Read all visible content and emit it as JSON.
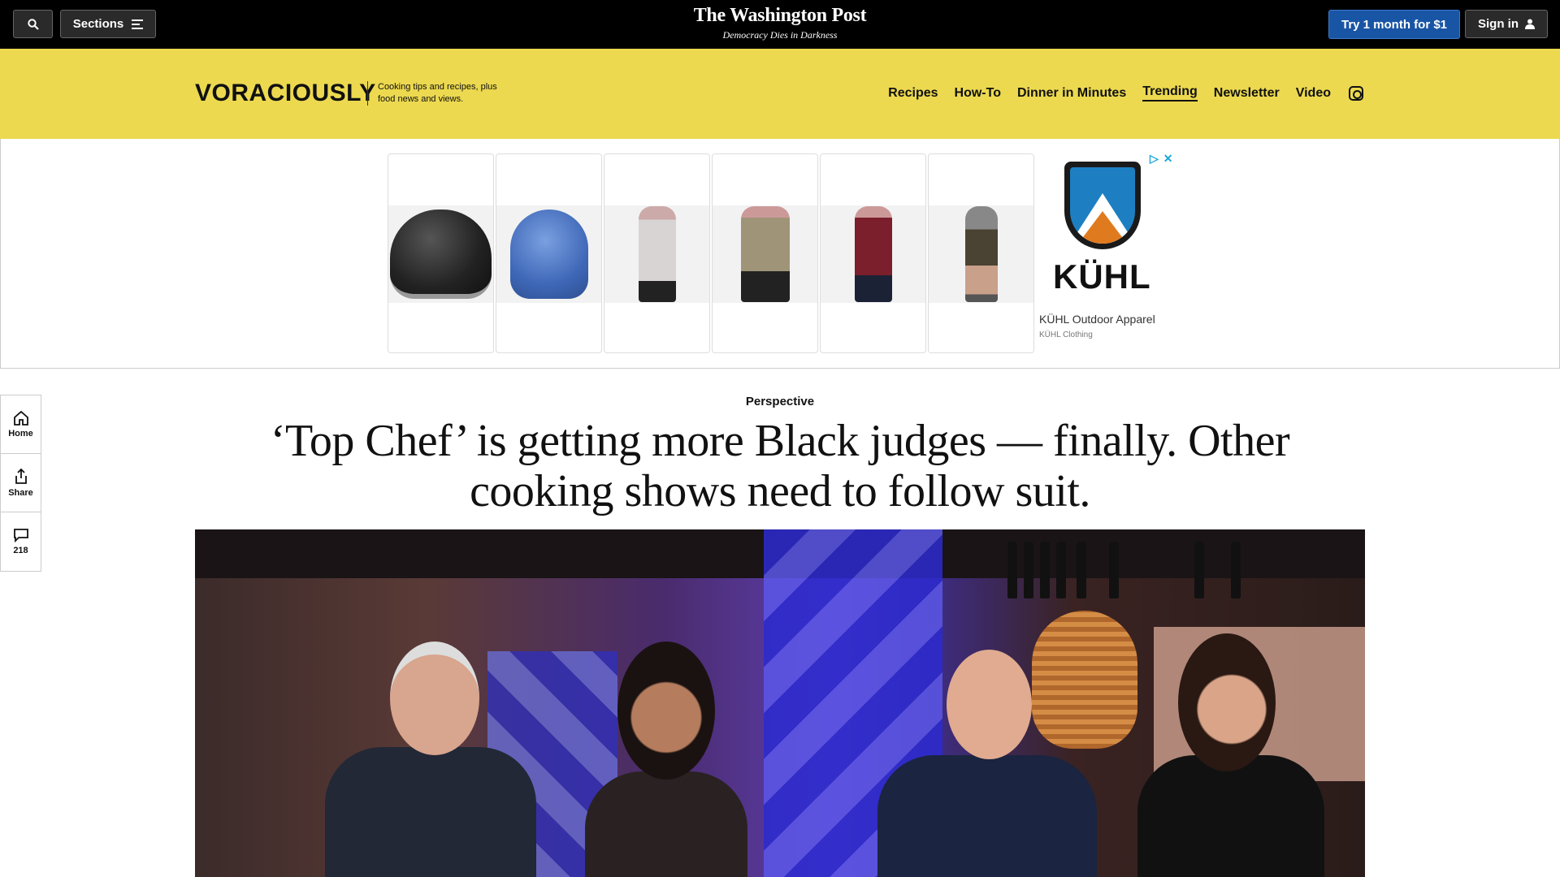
{
  "topbar": {
    "search_icon": "search-icon",
    "sections_label": "Sections",
    "logo": "The Washington Post",
    "tagline": "Democracy Dies in Darkness",
    "subscribe_label": "Try 1 month for $1",
    "signin_label": "Sign in",
    "accent_color": "#1955a5"
  },
  "section_bar": {
    "brand": "VORACIOUSLY",
    "tagline": "Cooking tips and recipes, plus food news and views.",
    "background": "#ecd94f",
    "nav": [
      "Recipes",
      "How-To",
      "Dinner in Minutes",
      "Trending",
      "Newsletter",
      "Video"
    ],
    "active_nav": "Trending",
    "social_icon": "instagram-icon"
  },
  "ad": {
    "products": [
      "black beanie",
      "blue trapper hat",
      "patterned jacket",
      "khaki pullover",
      "maroon pullover",
      "shorts"
    ],
    "brand_logo": "KÜHL",
    "title": "KÜHL Outdoor Apparel",
    "advertiser": "KÜHL Clothing"
  },
  "rail": {
    "home_label": "Home",
    "share_label": "Share",
    "comments_count": "218"
  },
  "article": {
    "kicker": "Perspective",
    "headline": "‘Top Chef’ is getting more Black judges — finally. Other cooking shows need to follow suit."
  }
}
